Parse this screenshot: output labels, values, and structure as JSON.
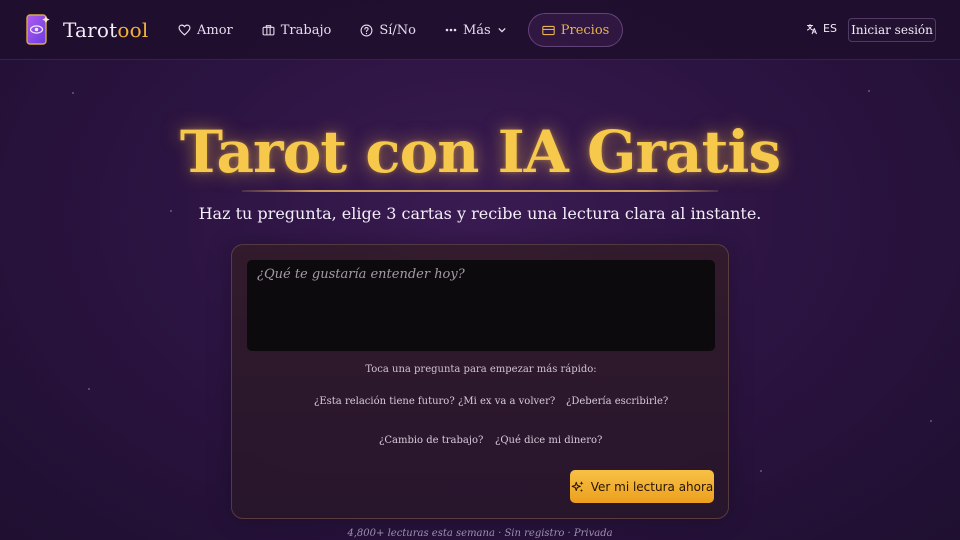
{
  "header": {
    "logo_prefix": "Tarot",
    "logo_accent": "ool",
    "nav": {
      "amor": "Amor",
      "trabajo": "Trabajo",
      "sino": "Sí/No",
      "mas": "Más",
      "precios": "Precios"
    },
    "lang": "ES",
    "login": "Iniciar sesión"
  },
  "hero": {
    "title": "Tarot con IA Gratis",
    "subtitle": "Haz tu pregunta, elige 3 cartas y recibe una lectura clara al instante."
  },
  "form": {
    "placeholder": "¿Qué te gustaría entender hoy?",
    "hint": "Toca una pregunta para empezar más rápido:",
    "suggestions": [
      "¿Esta relación tiene futuro?",
      "¿Mi ex va a volver?",
      "¿Debería escribirle?",
      "¿Cambio de trabajo?",
      "¿Qué dice mi dinero?"
    ],
    "cta": "Ver mi lectura ahora"
  },
  "footer_note": "4,800+ lecturas esta semana · Sin registro · Privada",
  "colors": {
    "accent": "#f6c84c",
    "cta": "#f1ad2e",
    "background": "#2c1442"
  },
  "icons": {
    "logo": "tarot-card-eye-icon",
    "amor": "heart-icon",
    "trabajo": "briefcase-icon",
    "sino": "question-circle-icon",
    "mas": "dots-icon",
    "precios": "credit-card-icon",
    "lang": "translate-icon",
    "cta": "sparkles-icon"
  }
}
